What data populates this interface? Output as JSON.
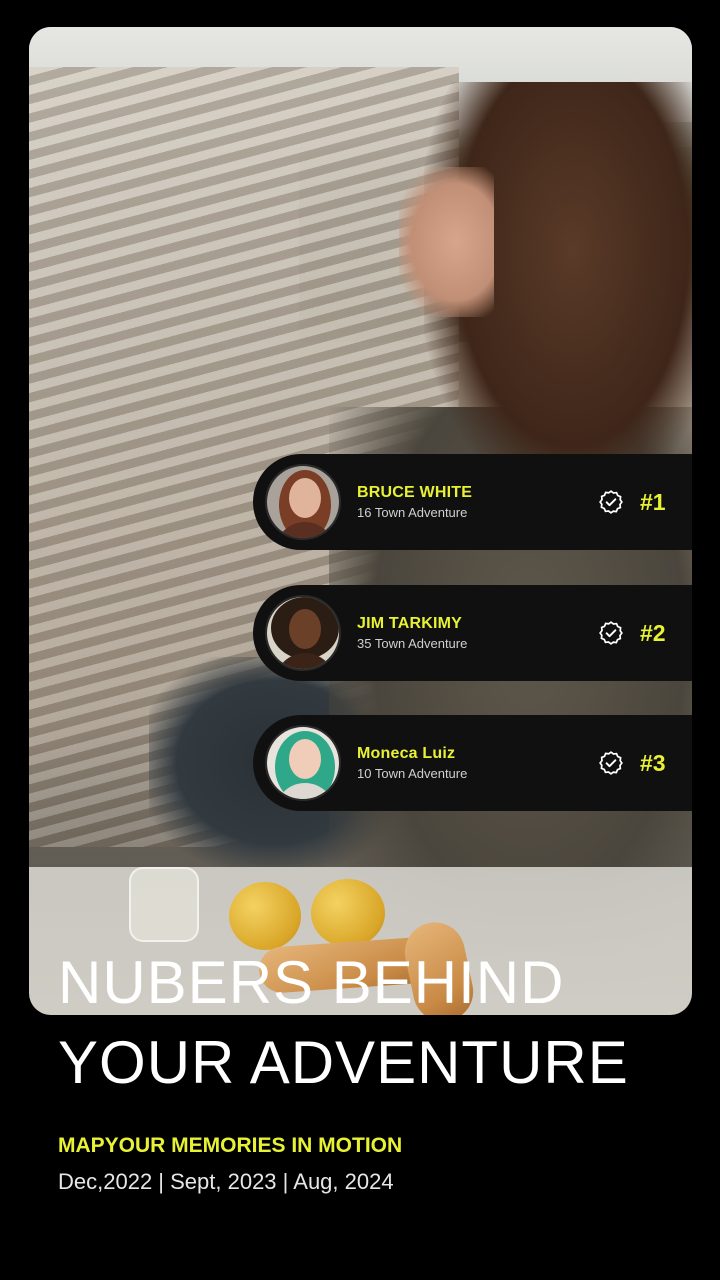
{
  "leaderboard": [
    {
      "name": "BRUCE WHITE",
      "subtitle": "16 Town Adventure",
      "rank": "#1"
    },
    {
      "name": "JIM TARKIMY",
      "subtitle": "35 Town Adventure",
      "rank": "#2"
    },
    {
      "name": "Moneca Luiz",
      "subtitle": "10 Town Adventure",
      "rank": "#3"
    }
  ],
  "headline": {
    "line1": "NUBERS BEHIND",
    "line2": "YOUR ADVENTURE"
  },
  "tagline": "MAPYOUR MEMORIES IN MOTION",
  "dates": "Dec,2022 | Sept, 2023 | Aug, 2024",
  "colors": {
    "accent": "#e8f233",
    "card": "#101010",
    "background": "#000000"
  },
  "icons": {
    "verified": "verified-badge-icon"
  }
}
